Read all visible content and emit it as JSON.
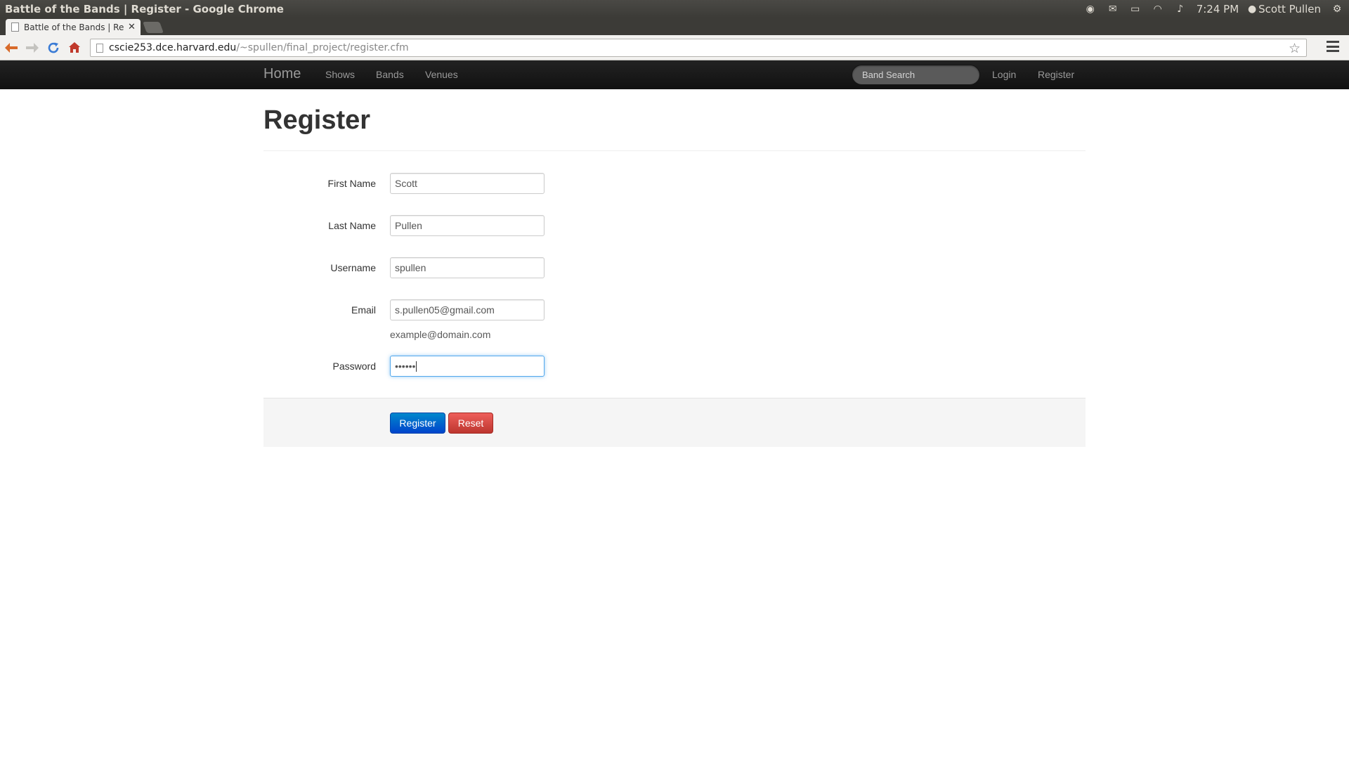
{
  "os": {
    "window_title": "Battle of the Bands | Register - Google Chrome",
    "time": "7:24 PM",
    "user": "Scott Pullen",
    "icons": [
      "dropbox-icon",
      "mail-icon",
      "battery-icon",
      "wifi-icon",
      "volume-icon",
      "user-icon",
      "settings-icon"
    ]
  },
  "browser": {
    "tab_title": "Battle of the Bands | Register",
    "url_host": "cscie253.dce.harvard.edu",
    "url_path": "/~spullen/final_project/register.cfm"
  },
  "navbar": {
    "brand": "Home",
    "links": [
      "Shows",
      "Bands",
      "Venues"
    ],
    "search_placeholder": "Band Search",
    "right_links": [
      "Login",
      "Register"
    ]
  },
  "page": {
    "title": "Register",
    "fields": {
      "first_name": {
        "label": "First Name",
        "value": "Scott"
      },
      "last_name": {
        "label": "Last Name",
        "value": "Pullen"
      },
      "username": {
        "label": "Username",
        "value": "spullen"
      },
      "email": {
        "label": "Email",
        "value": "s.pullen05@gmail.com",
        "help": "example@domain.com"
      },
      "password": {
        "label": "Password",
        "value": "••••••"
      }
    },
    "buttons": {
      "register": "Register",
      "reset": "Reset"
    }
  },
  "colors": {
    "primary": "#0055cc",
    "danger": "#da4f49",
    "navbar": "#1b1b1b"
  }
}
